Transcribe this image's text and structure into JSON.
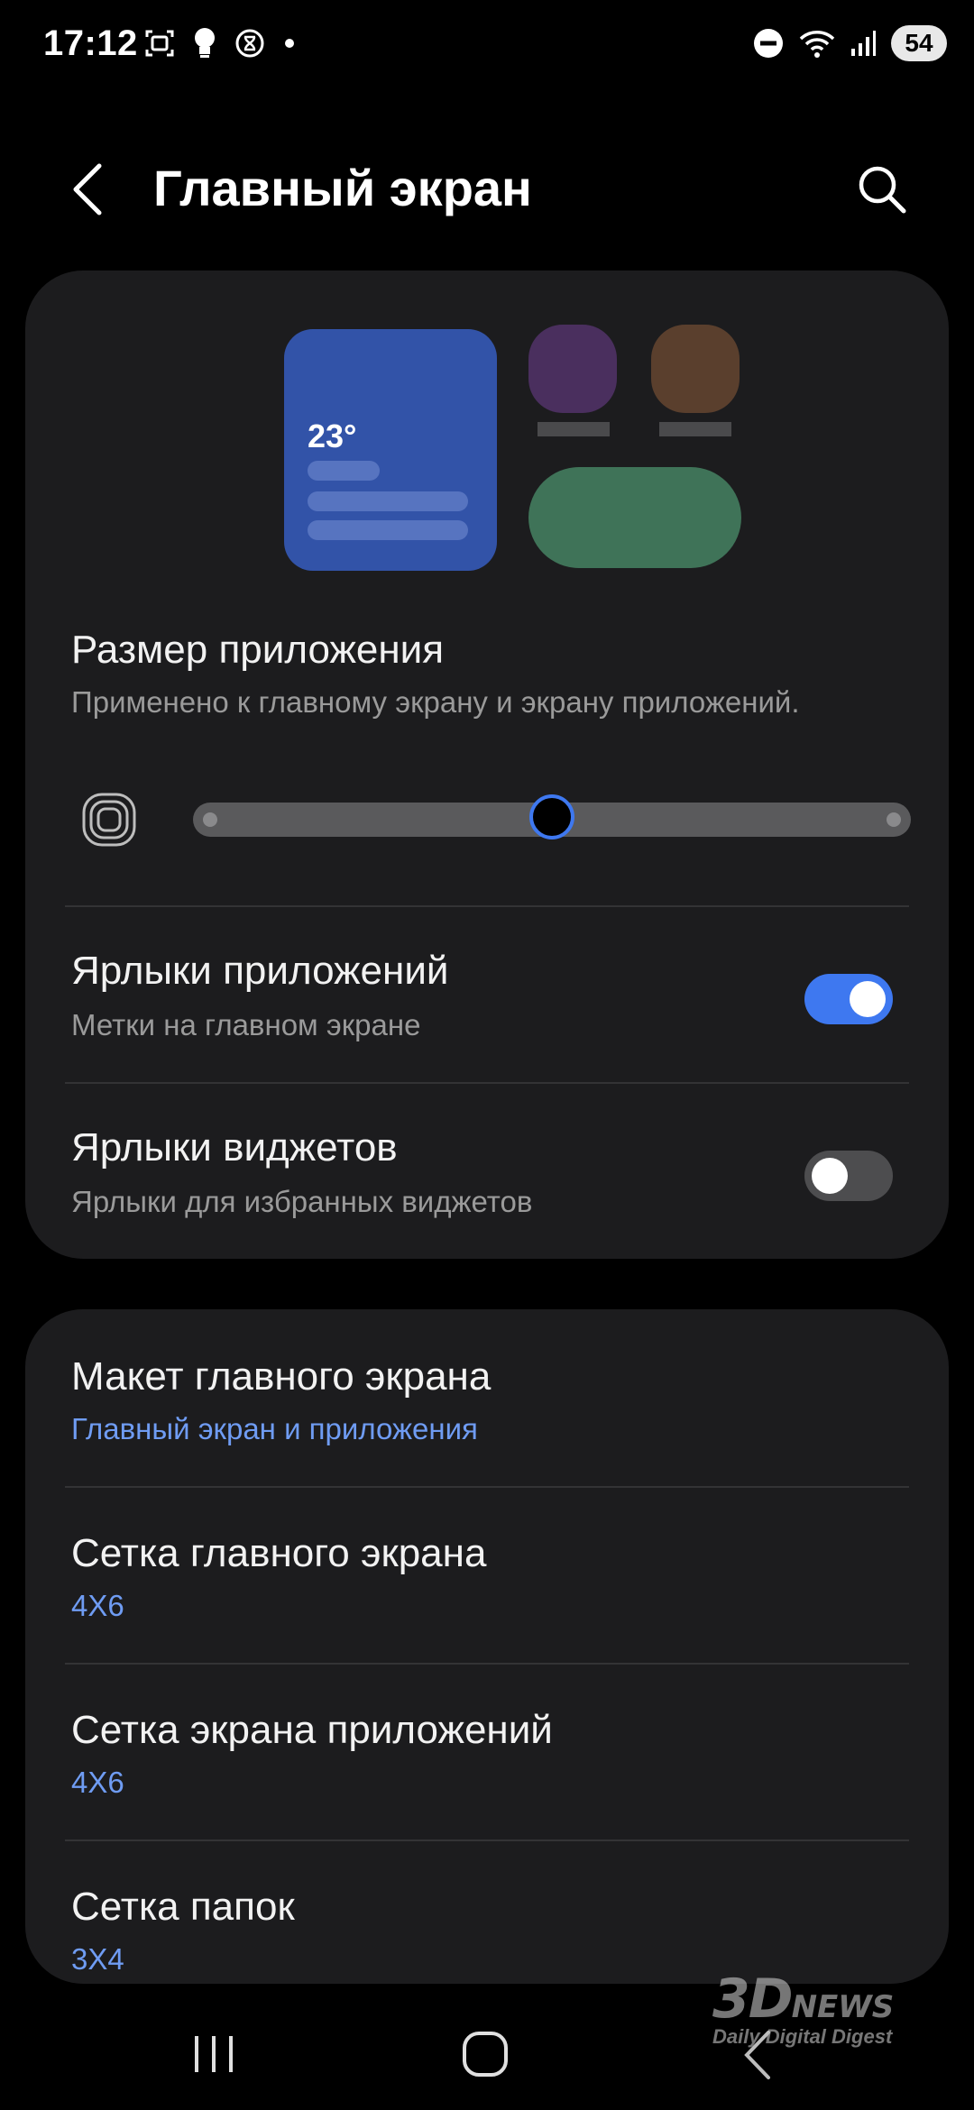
{
  "status_bar": {
    "time": "17:12",
    "battery": "54"
  },
  "header": {
    "title": "Главный экран"
  },
  "preview": {
    "temperature": "23°"
  },
  "app_size": {
    "title": "Размер приложения",
    "subtitle": "Применено к главному экрану и экрану приложений.",
    "slider_level": 0.5
  },
  "app_labels": {
    "title": "Ярлыки приложений",
    "subtitle": "Метки на главном экране",
    "enabled": true
  },
  "widget_labels": {
    "title": "Ярлыки виджетов",
    "subtitle": "Ярлыки для избранных виджетов",
    "enabled": false
  },
  "layout_items": [
    {
      "title": "Макет главного экрана",
      "value": "Главный экран и приложения"
    },
    {
      "title": "Сетка главного экрана",
      "value": "4X6"
    },
    {
      "title": "Сетка экрана приложений",
      "value": "4X6"
    },
    {
      "title": "Сетка папок",
      "value": "3X4"
    }
  ],
  "watermark": {
    "logo": "3D",
    "logo_suffix": "NEWS",
    "tagline": "Daily Digital Digest"
  },
  "colors": {
    "accent": "#3e78f0",
    "link": "#6f9cf3",
    "card": "#1c1c1e"
  }
}
